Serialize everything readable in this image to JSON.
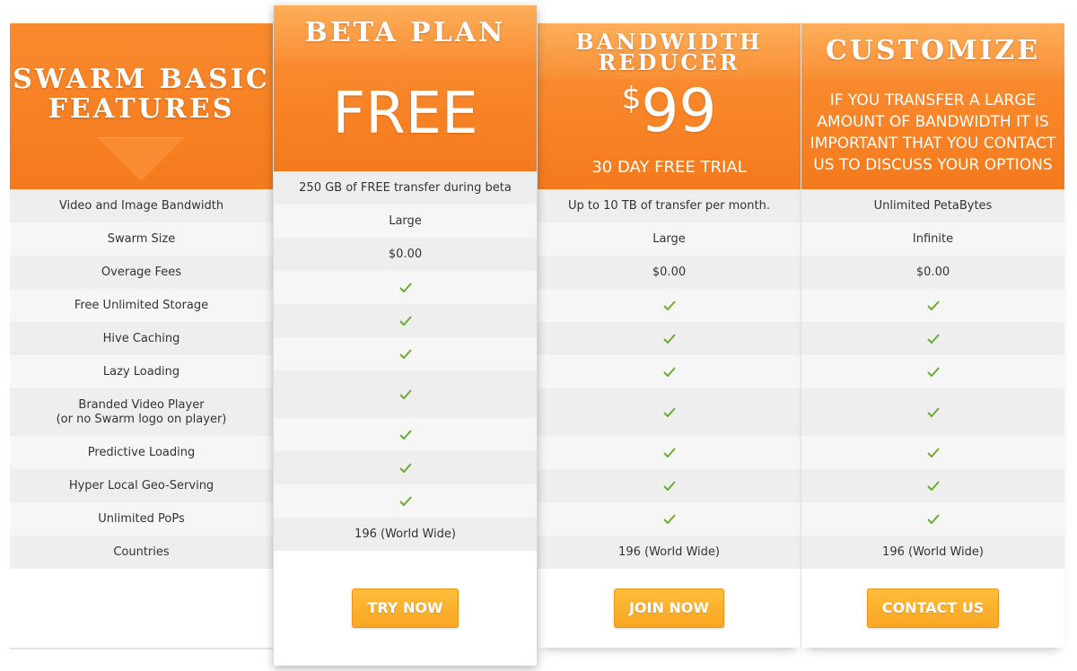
{
  "colors": {
    "accent_orange": "#f47a1c",
    "header_top_orange": "#fba24e",
    "button_yellow": "#fbb030",
    "check_green": "#6aad2c",
    "row_light": "#f6f6f6",
    "row_dark": "#eeeeee"
  },
  "features": {
    "title": "Swarm Basic Features",
    "rows": [
      "Video and Image Bandwidth",
      "Swarm Size",
      "Overage Fees",
      "Free Unlimited Storage",
      "Hive Caching",
      "Lazy Loading",
      "Branded Video Player",
      "(or no Swarm logo on player)",
      "Predictive Loading",
      "Hyper Local Geo-Serving",
      "Unlimited PoPs",
      "Countries"
    ]
  },
  "plans": {
    "beta": {
      "name": "Beta Plan",
      "price": "FREE",
      "transfer": "250 GB of FREE transfer during beta",
      "swarm_size": "Large",
      "overage": "$0.00",
      "checks": [
        "check-icon",
        "check-icon",
        "check-icon",
        "check-icon",
        "check-icon",
        "check-icon",
        "check-icon"
      ],
      "countries": "196 (World Wide)",
      "button": "Try Now"
    },
    "bandwidth": {
      "name_line1": "Bandwidth",
      "name_line2": "Reducer",
      "currency": "$",
      "price": "99",
      "trial": "30 Day Free Trial",
      "transfer": "Up to 10 TB of transfer per month.",
      "swarm_size": "Large",
      "overage": "$0.00",
      "countries": "196 (World Wide)",
      "button": "Join Now"
    },
    "customize": {
      "name": "Customize",
      "description": "If you transfer a large amount of bandwidth it is important that you contact us to discuss your options",
      "transfer": "Unlimited PetaBytes",
      "swarm_size": "Infinite",
      "overage": "$0.00",
      "countries": "196 (World Wide)",
      "button": "Contact Us"
    }
  }
}
